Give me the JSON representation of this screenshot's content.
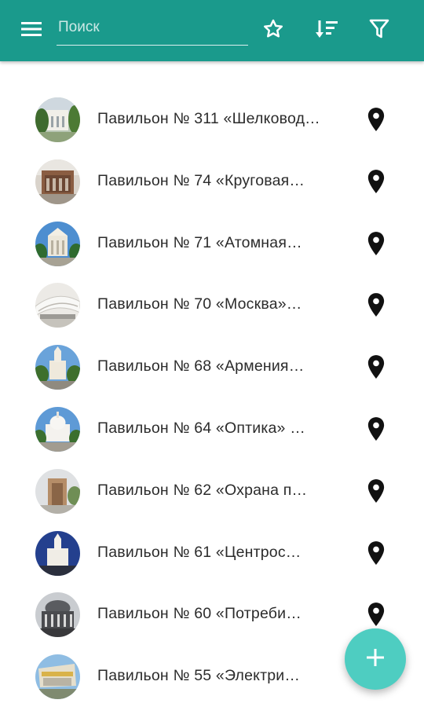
{
  "colors": {
    "appbar": "#1a9a8c",
    "fab": "#4ecdc1",
    "text": "#2b2b2b",
    "pin": "#111111"
  },
  "appbar": {
    "menu_icon": "hamburger-menu-icon",
    "search_placeholder": "Поиск",
    "search_value": "",
    "favorites_icon": "star-outline-icon",
    "sort_icon": "sort-icon",
    "filter_icon": "filter-icon"
  },
  "pavilions": [
    {
      "title": "Павильон № 311 «Шелковод…",
      "thumb_icon": "pavilion-photo"
    },
    {
      "title": "Павильон № 74 «Круговая…",
      "thumb_icon": "pavilion-photo"
    },
    {
      "title": "Павильон № 71 «Атомная…",
      "thumb_icon": "pavilion-photo"
    },
    {
      "title": "Павильон № 70 «Москва»…",
      "thumb_icon": "pavilion-photo"
    },
    {
      "title": "Павильон № 68 «Армения…",
      "thumb_icon": "pavilion-photo"
    },
    {
      "title": "Павильон № 64 «Оптика» …",
      "thumb_icon": "pavilion-photo"
    },
    {
      "title": "Павильон № 62 «Охрана п…",
      "thumb_icon": "pavilion-photo"
    },
    {
      "title": "Павильон № 61 «Центрос…",
      "thumb_icon": "pavilion-photo"
    },
    {
      "title": "Павильон № 60 «Потреби…",
      "thumb_icon": "pavilion-photo"
    },
    {
      "title": "Павильон № 55 «Электри…",
      "thumb_icon": "pavilion-photo"
    }
  ],
  "fab": {
    "icon": "plus-icon"
  }
}
